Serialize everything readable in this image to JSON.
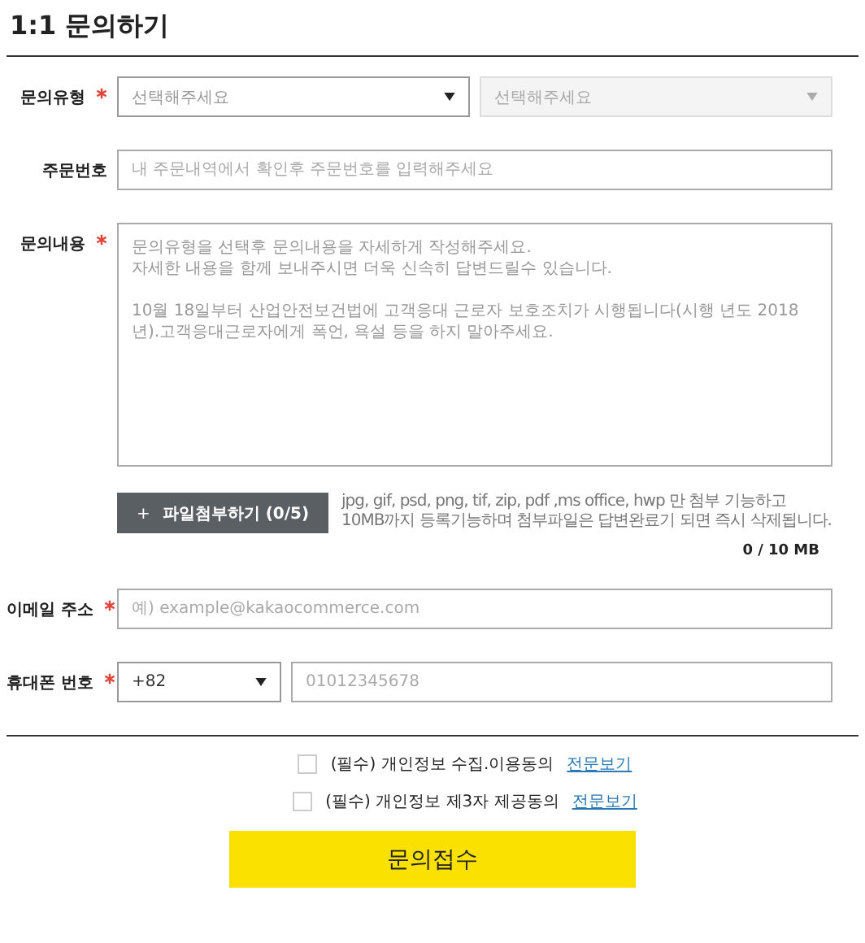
{
  "title": "1:1 문의하기",
  "fields": [
    {
      "kind": "select-pair",
      "label": "문의유형",
      "required": true,
      "selects": [
        {
          "value": "선택해주세요",
          "disabled": false
        },
        {
          "value": "선택해주세요",
          "disabled": true
        }
      ]
    },
    {
      "kind": "text",
      "label": "주문번호",
      "required": false,
      "placeholder": "내 주문내역에서 확인후 주문번호를 입력해주세요"
    },
    {
      "kind": "textarea",
      "label": "문의내용",
      "required": true,
      "placeholder_paragraphs": [
        [
          "문의유형을 선택후 문의내용을 자세하게 작성해주세요.",
          "자세한 내용을 함께 보내주시면 더욱 신속히 답변드릴수 있습니다."
        ],
        [
          "10월 18일부터 산업안전보건법에 고객응대 근로자 보호조치가 시행됩니다(시행 년도 2018년).고객응대근로자에게 폭언, 욕설 등을 하지 말아주세요."
        ]
      ]
    }
  ],
  "attach": {
    "icon": "+",
    "label": "파일첨부하기 (0/5)",
    "hint_lines": [
      "jpg, gif, psd, png, tif, zip, pdf ,ms office, hwp 만 첨부 기능하고",
      "10MB까지 등록기능하며 첨부파일은 답변완료기 되면 즉시 삭제됩니다."
    ],
    "size": "0 / 10 MB"
  },
  "contact": [
    {
      "kind": "text",
      "label": "이메일 주소",
      "required": true,
      "placeholder": "예) example@kakaocommerce.com"
    },
    {
      "kind": "phone",
      "label": "휴대폰 번호",
      "required": true,
      "code": "+82",
      "placeholder": "01012345678"
    }
  ],
  "agreements": [
    {
      "label": "(필수) 개인정보 수집.이용동의",
      "checked": false,
      "link": "전문보기"
    },
    {
      "label": "(필수) 개인정보 제3자 제공동의",
      "checked": false,
      "link": "전문보기"
    }
  ],
  "submit": "문의접수"
}
